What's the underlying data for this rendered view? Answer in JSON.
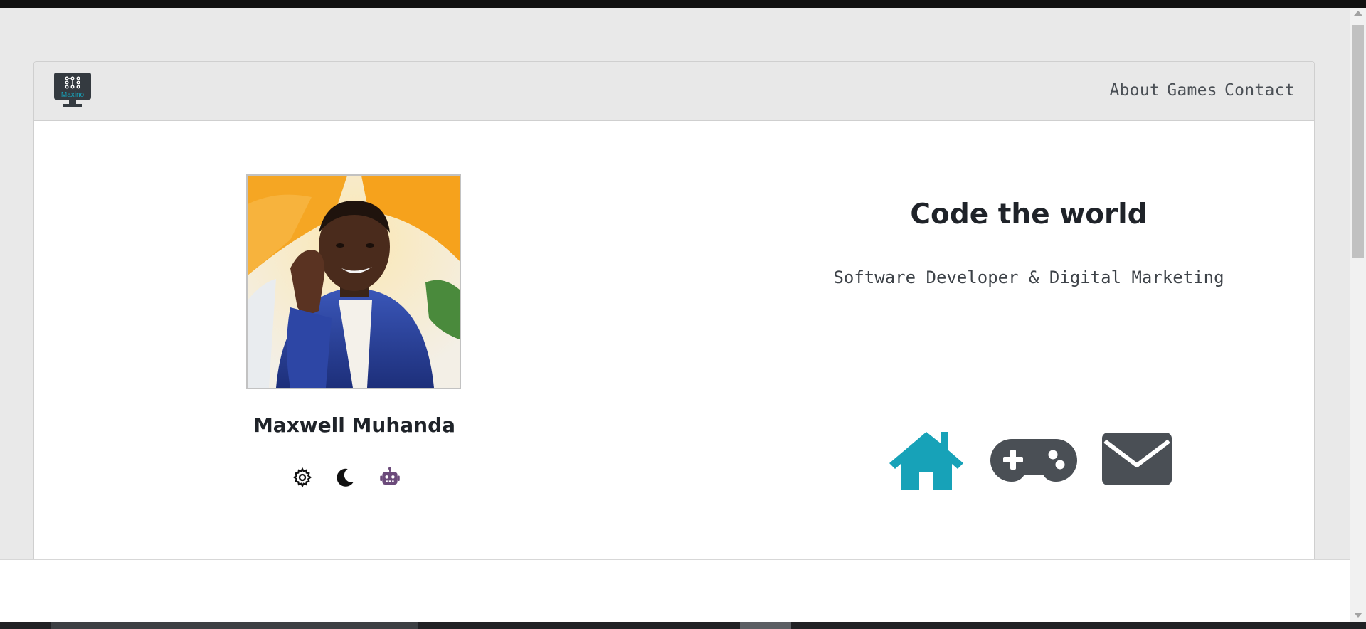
{
  "navbar": {
    "logo_text": "Maxino",
    "links": [
      "About",
      "Games",
      "Contact"
    ]
  },
  "profile": {
    "name": "Maxwell Muhanda"
  },
  "theme_icons": [
    "gear-icon",
    "moon-icon",
    "robot-icon"
  ],
  "hero": {
    "title": "Code the world",
    "subtitle": "Software Developer & Digital Marketing"
  },
  "nav_icons": [
    "home-icon",
    "gamepad-icon",
    "envelope-icon"
  ],
  "colors": {
    "accent": "#17a2b8",
    "icon_dark": "#4a4f55",
    "robot": "#6b4a7a",
    "page_bg": "#e9e9e9",
    "navbar_bg": "#e8e8e8"
  }
}
